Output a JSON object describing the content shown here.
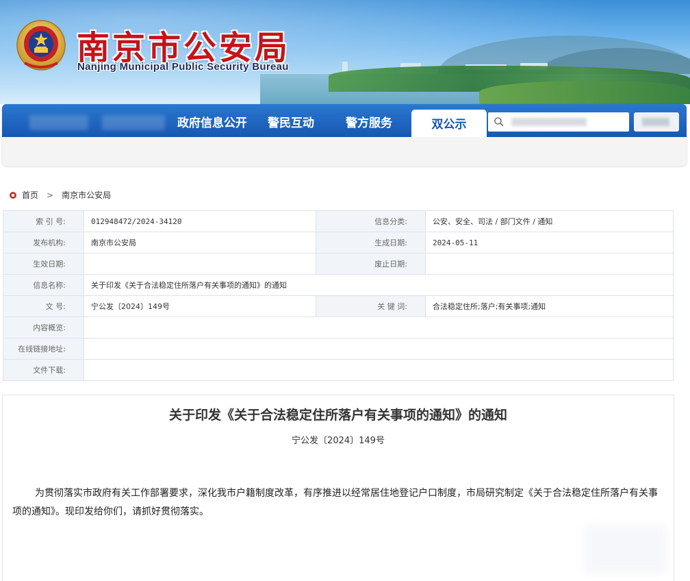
{
  "header": {
    "title_zh": "南京市公安局",
    "title_en": "Nanjing Municipal Public Security Bureau"
  },
  "nav": {
    "items": [
      "政府信息公开",
      "警民互动",
      "警方服务"
    ],
    "active": "双公示"
  },
  "breadcrumb": {
    "home": "首页",
    "current": "南京市公安局"
  },
  "info": {
    "index_label": "索  引  号:",
    "index_value": "012948472/2024-34120",
    "category_label": "信息分类:",
    "category_value": "公安、安全、司法 / 部门文件 / 通知",
    "publisher_label": "发布机构:",
    "publisher_value": "南京市公安局",
    "created_label": "生成日期:",
    "created_value": "2024-05-11",
    "effective_label": "生效日期:",
    "effective_value": "",
    "abolished_label": "废止日期:",
    "abolished_value": "",
    "name_label": "信息名称:",
    "name_value": "关于印发《关于合法稳定住所落户有关事项的通知》的通知",
    "docno_label": "文       号:",
    "docno_value": "宁公发〔2024〕149号",
    "keywords_label": "关  键  词:",
    "keywords_value": "合法稳定住所;落户;有关事项;通知",
    "summary_label": "内容概览:",
    "summary_value": "",
    "link_label": "在线链接地址:",
    "link_value": "",
    "download_label": "文件下载:",
    "download_value": ""
  },
  "article": {
    "title": "关于印发《关于合法稳定住所落户有关事项的通知》的通知",
    "doc_number": "宁公发〔2024〕149号",
    "body": "为贯彻落实市政府有关工作部署要求，深化我市户籍制度改革，有序推进以经常居住地登记户口制度，市局研究制定《关于合法稳定住所落户有关事项的通知》。现印发给你们，请抓好贯彻落实。"
  },
  "colors": {
    "nav_blue": "#1757b2",
    "title_red": "#c4141b",
    "label_bg": "#f1f5fa"
  }
}
